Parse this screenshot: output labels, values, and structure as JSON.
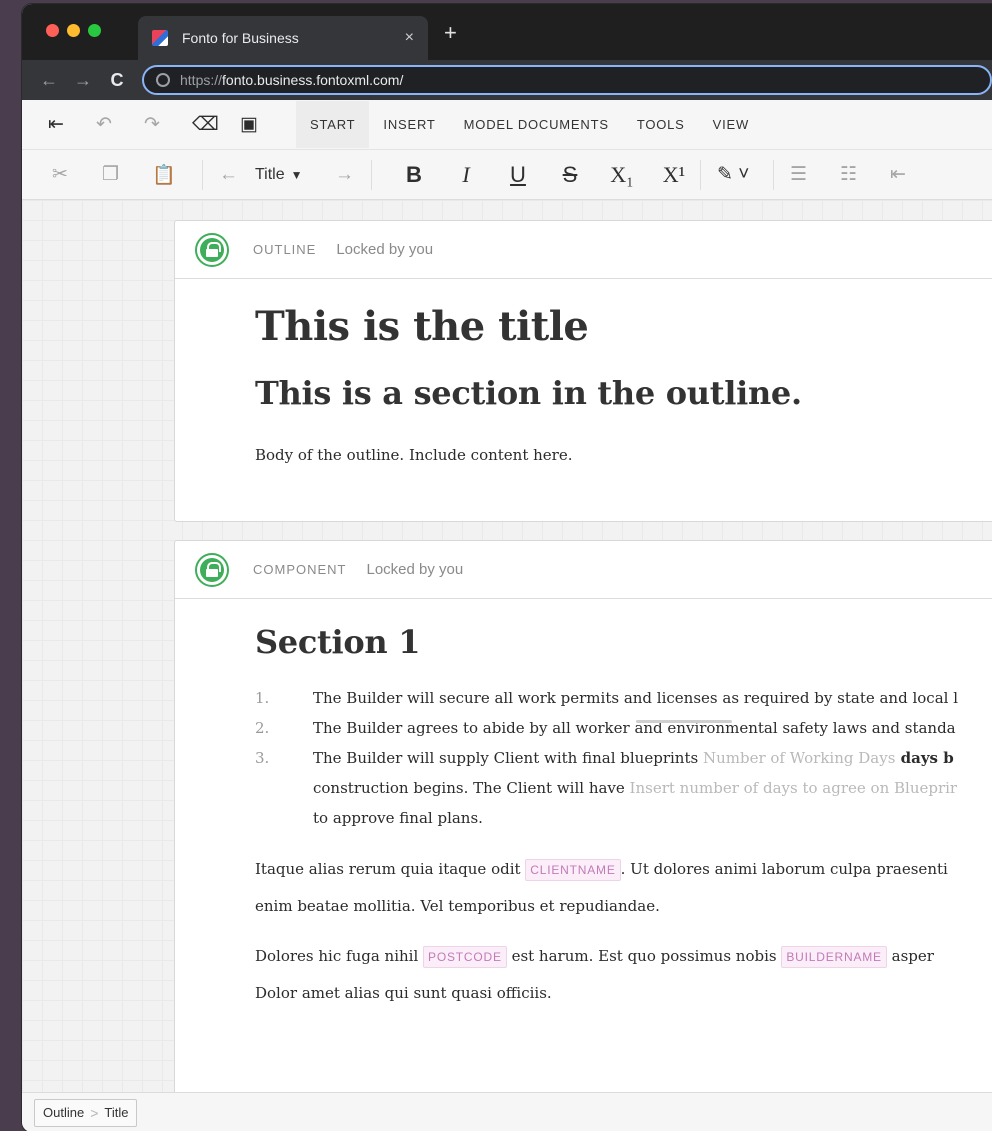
{
  "browser": {
    "tab_title": "Fonto for Business",
    "tab_close": "×",
    "new_tab": "+",
    "url_scheme": "https://",
    "url_host": "fonto.business.fontoxml.com/"
  },
  "menubar": {
    "tabs": [
      "START",
      "INSERT",
      "MODEL DOCUMENTS",
      "TOOLS",
      "VIEW"
    ]
  },
  "formatbar": {
    "style_value": "Title",
    "bold": "B",
    "italic": "I",
    "underline": "U",
    "strike": "S",
    "subscript": "X₁",
    "superscript": "X¹"
  },
  "outline_card": {
    "type": "OUTLINE",
    "lock_state": "Locked by you",
    "title": "This is the title",
    "section": "This is a section in the outline.",
    "body": "Body of the outline. Include content here."
  },
  "component_card": {
    "type": "COMPONENT",
    "lock_state": "Locked by you",
    "heading": "Section 1",
    "items": [
      {
        "num": "1.",
        "text": "The Builder will secure all work permits and licenses as required by state and local l"
      },
      {
        "num": "2.",
        "text": "The Builder agrees to abide by all worker and environmental safety laws and standa"
      },
      {
        "num": "3.",
        "text_a": "The Builder will supply Client with final blueprints ",
        "placeholder_a": "Number of Working Days",
        "text_b": " days b"
      }
    ],
    "item3_line2_a": "construction begins. The Client will have ",
    "item3_line2_placeholder": "Insert number of days to agree on Blueprir",
    "item3_line3": "to approve final plans.",
    "para1_a": "Itaque alias rerum quia itaque odit ",
    "para1_var": "CLIENTNAME",
    "para1_b": ". Ut dolores animi laborum culpa praesenti",
    "para1_line2": "enim beatae mollitia. Vel temporibus et repudiandae.",
    "para2_a": "Dolores hic fuga nihil ",
    "para2_var1": "POSTCODE",
    "para2_b": " est harum. Est quo possimus nobis ",
    "para2_var2": "BUILDERNAME",
    "para2_c": " asper",
    "para2_line2": "Dolor amet alias qui sunt quasi officiis."
  },
  "statusbar": {
    "crumbs": [
      "Outline",
      "Title"
    ]
  },
  "colors": {
    "lock_green": "#3fae5a",
    "variable_pink": "#c17bb8",
    "omnibox_focus": "#8ab4f8"
  },
  "icons": [
    "back-arrow-icon",
    "forward-arrow-icon",
    "reload-icon",
    "globe-icon",
    "exit-icon",
    "undo-icon",
    "redo-icon",
    "eraser-icon",
    "save-icon",
    "cut-icon",
    "copy-icon",
    "paste-icon",
    "lock-icon",
    "highlighter-icon",
    "numbered-list-icon",
    "bullet-list-icon",
    "outdent-icon"
  ]
}
